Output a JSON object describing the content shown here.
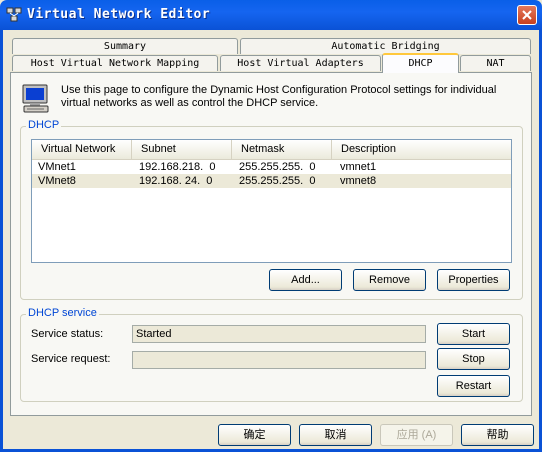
{
  "window": {
    "title": "Virtual Network Editor"
  },
  "tabs": {
    "row1": [
      "Summary",
      "Automatic Bridging"
    ],
    "row2": [
      "Host Virtual Network Mapping",
      "Host Virtual Adapters",
      "DHCP",
      "NAT"
    ],
    "active": "DHCP"
  },
  "info": {
    "text": "Use this page to configure the Dynamic Host Configuration Protocol settings for individual virtual networks as well as control the DHCP service."
  },
  "dhcp": {
    "group_label": "DHCP",
    "columns": [
      "Virtual Network",
      "Subnet",
      "Netmask",
      "Description"
    ],
    "rows": [
      [
        "VMnet1",
        "192.168.218.  0",
        "255.255.255.  0",
        "vmnet1"
      ],
      [
        "VMnet8",
        "192.168. 24.  0",
        "255.255.255.  0",
        "vmnet8"
      ]
    ],
    "buttons": {
      "add": "Add...",
      "remove": "Remove",
      "properties": "Properties"
    }
  },
  "service": {
    "group_label": "DHCP service",
    "status_label": "Service status:",
    "status_value": "Started",
    "request_label": "Service request:",
    "request_value": "",
    "buttons": {
      "start": "Start",
      "stop": "Stop",
      "restart": "Restart"
    }
  },
  "footer": {
    "ok": "确定",
    "cancel": "取消",
    "apply": "应用 (A)",
    "help": "帮助"
  },
  "colors": {
    "titlebar": "#0a5fe8",
    "group_label": "#0046d5",
    "active_tab_accent": "#ffc83c",
    "close_button": "#c8401e"
  }
}
